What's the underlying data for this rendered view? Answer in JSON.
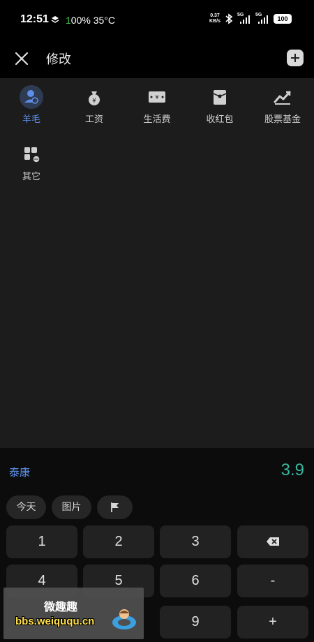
{
  "status_bar": {
    "time": "12:51",
    "battery_percent_text": "00%",
    "battery_percent_lead": "1",
    "temperature": "35°C",
    "net_speed_value": "0.37",
    "net_speed_unit": "KB/s",
    "signal1_label": "5G",
    "signal2_label": "5G",
    "battery_level": "100",
    "icons": [
      "layers-icon",
      "bluetooth-icon",
      "signal-icon",
      "signal-icon",
      "battery-icon"
    ]
  },
  "header": {
    "title": "修改",
    "close_icon": "close-icon",
    "add_icon": "add-icon"
  },
  "categories": [
    {
      "label": "羊毛",
      "icon": "person-icon",
      "selected": true
    },
    {
      "label": "工资",
      "icon": "money-bag-icon",
      "selected": false
    },
    {
      "label": "生活费",
      "icon": "banknote-icon",
      "selected": false
    },
    {
      "label": "收红包",
      "icon": "red-envelope-icon",
      "selected": false
    },
    {
      "label": "股票基金",
      "icon": "stock-chart-icon",
      "selected": false
    },
    {
      "label": "其它",
      "icon": "other-grid-icon",
      "selected": false
    }
  ],
  "entry": {
    "note": "泰康",
    "amount": "3.9"
  },
  "chips": {
    "today": "今天",
    "image": "图片",
    "flag_icon": "flag-icon"
  },
  "keypad": {
    "k1": "1",
    "k2": "2",
    "k3": "3",
    "k4": "4",
    "k5": "5",
    "k6": "6",
    "k9": "9",
    "minus": "-",
    "plus": "+",
    "backspace_icon": "backspace-icon"
  },
  "watermark": {
    "title": "微趣趣",
    "url": "bbs.weiququ.cn"
  },
  "colors": {
    "accent_blue": "#5b8fe8",
    "amount_teal": "#3ab7a0",
    "battery_green": "#41c453"
  }
}
